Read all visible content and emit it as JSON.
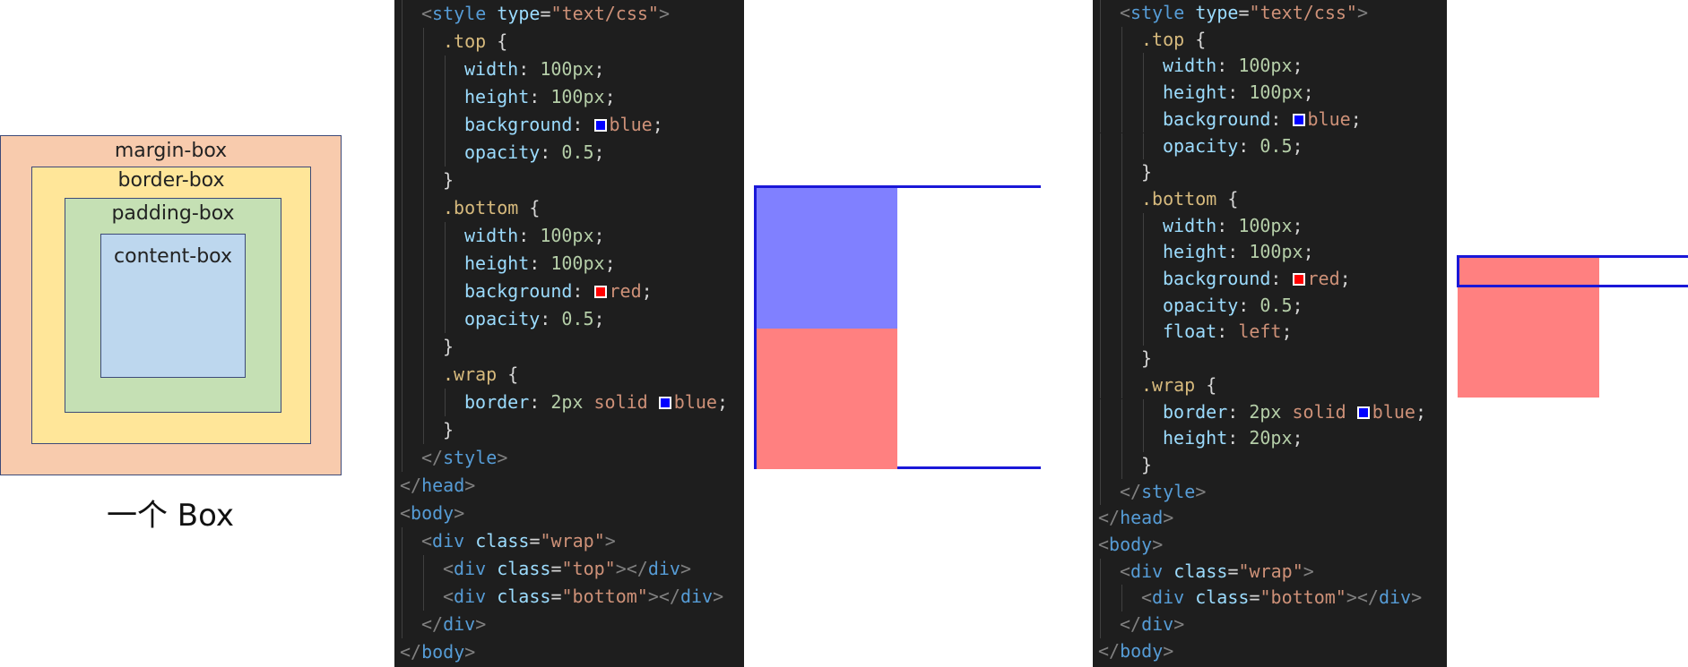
{
  "box_model": {
    "margin_box": "margin-box",
    "border_box": "border-box",
    "padding_box": "padding-box",
    "content_box": "content-box",
    "caption": "一个 Box",
    "colors": {
      "margin": "#f8cbad",
      "border": "#ffe699",
      "padding": "#c5e0b4",
      "content": "#bdd7ee"
    }
  },
  "code1": {
    "lines": [
      {
        "indent": 1,
        "tokens": [
          [
            "t-punc",
            "<"
          ],
          [
            "t-tag",
            "style"
          ],
          [
            "t-text",
            " "
          ],
          [
            "t-attr",
            "type"
          ],
          [
            "t-text",
            "="
          ],
          [
            "t-str",
            "\"text/css\""
          ],
          [
            "t-punc",
            ">"
          ]
        ]
      },
      {
        "indent": 2,
        "tokens": [
          [
            "t-sel",
            ".top"
          ],
          [
            "t-text",
            " {"
          ]
        ]
      },
      {
        "indent": 3,
        "tokens": [
          [
            "t-prop",
            "width"
          ],
          [
            "t-text",
            ": "
          ],
          [
            "t-num",
            "100px"
          ],
          [
            "t-text",
            ";"
          ]
        ]
      },
      {
        "indent": 3,
        "tokens": [
          [
            "t-prop",
            "height"
          ],
          [
            "t-text",
            ": "
          ],
          [
            "t-num",
            "100px"
          ],
          [
            "t-text",
            ";"
          ]
        ]
      },
      {
        "indent": 3,
        "tokens": [
          [
            "t-prop",
            "background"
          ],
          [
            "t-text",
            ": "
          ],
          [
            "swatch",
            "#0000ff"
          ],
          [
            "t-val",
            "blue"
          ],
          [
            "t-text",
            ";"
          ]
        ]
      },
      {
        "indent": 3,
        "tokens": [
          [
            "t-prop",
            "opacity"
          ],
          [
            "t-text",
            ": "
          ],
          [
            "t-num",
            "0.5"
          ],
          [
            "t-text",
            ";"
          ]
        ]
      },
      {
        "indent": 2,
        "tokens": [
          [
            "t-text",
            "}"
          ]
        ]
      },
      {
        "indent": 2,
        "tokens": [
          [
            "t-sel",
            ".bottom"
          ],
          [
            "t-text",
            " {"
          ]
        ]
      },
      {
        "indent": 3,
        "tokens": [
          [
            "t-prop",
            "width"
          ],
          [
            "t-text",
            ": "
          ],
          [
            "t-num",
            "100px"
          ],
          [
            "t-text",
            ";"
          ]
        ]
      },
      {
        "indent": 3,
        "tokens": [
          [
            "t-prop",
            "height"
          ],
          [
            "t-text",
            ": "
          ],
          [
            "t-num",
            "100px"
          ],
          [
            "t-text",
            ";"
          ]
        ]
      },
      {
        "indent": 3,
        "tokens": [
          [
            "t-prop",
            "background"
          ],
          [
            "t-text",
            ": "
          ],
          [
            "swatch",
            "#ff0000"
          ],
          [
            "t-val",
            "red"
          ],
          [
            "t-text",
            ";"
          ]
        ]
      },
      {
        "indent": 3,
        "tokens": [
          [
            "t-prop",
            "opacity"
          ],
          [
            "t-text",
            ": "
          ],
          [
            "t-num",
            "0.5"
          ],
          [
            "t-text",
            ";"
          ]
        ]
      },
      {
        "indent": 2,
        "tokens": [
          [
            "t-text",
            "}"
          ]
        ]
      },
      {
        "indent": 2,
        "tokens": [
          [
            "t-sel",
            ".wrap"
          ],
          [
            "t-text",
            " {"
          ]
        ]
      },
      {
        "indent": 3,
        "tokens": [
          [
            "t-prop",
            "border"
          ],
          [
            "t-text",
            ": "
          ],
          [
            "t-num",
            "2px"
          ],
          [
            "t-text",
            " "
          ],
          [
            "t-val",
            "solid"
          ],
          [
            "t-text",
            " "
          ],
          [
            "swatch",
            "#0000ff"
          ],
          [
            "t-val",
            "blue"
          ],
          [
            "t-text",
            ";"
          ]
        ]
      },
      {
        "indent": 2,
        "tokens": [
          [
            "t-text",
            "}"
          ]
        ]
      },
      {
        "indent": 1,
        "tokens": [
          [
            "t-punc",
            "</"
          ],
          [
            "t-tag",
            "style"
          ],
          [
            "t-punc",
            ">"
          ]
        ]
      },
      {
        "indent": 0,
        "tokens": [
          [
            "t-punc",
            "</"
          ],
          [
            "t-tag",
            "head"
          ],
          [
            "t-punc",
            ">"
          ]
        ]
      },
      {
        "indent": 0,
        "tokens": [
          [
            "t-punc",
            "<"
          ],
          [
            "t-tag",
            "body"
          ],
          [
            "t-punc",
            ">"
          ]
        ]
      },
      {
        "indent": 1,
        "tokens": [
          [
            "t-punc",
            "<"
          ],
          [
            "t-tag",
            "div"
          ],
          [
            "t-text",
            " "
          ],
          [
            "t-attr",
            "class"
          ],
          [
            "t-text",
            "="
          ],
          [
            "t-str",
            "\"wrap\""
          ],
          [
            "t-punc",
            ">"
          ]
        ]
      },
      {
        "indent": 2,
        "tokens": [
          [
            "t-punc",
            "<"
          ],
          [
            "t-tag",
            "div"
          ],
          [
            "t-text",
            " "
          ],
          [
            "t-attr",
            "class"
          ],
          [
            "t-text",
            "="
          ],
          [
            "t-str",
            "\"top\""
          ],
          [
            "t-punc",
            "></"
          ],
          [
            "t-tag",
            "div"
          ],
          [
            "t-punc",
            ">"
          ]
        ]
      },
      {
        "indent": 2,
        "tokens": [
          [
            "t-punc",
            "<"
          ],
          [
            "t-tag",
            "div"
          ],
          [
            "t-text",
            " "
          ],
          [
            "t-attr",
            "class"
          ],
          [
            "t-text",
            "="
          ],
          [
            "t-str",
            "\"bottom\""
          ],
          [
            "t-punc",
            "></"
          ],
          [
            "t-tag",
            "div"
          ],
          [
            "t-punc",
            ">"
          ]
        ]
      },
      {
        "indent": 1,
        "tokens": [
          [
            "t-punc",
            "</"
          ],
          [
            "t-tag",
            "div"
          ],
          [
            "t-punc",
            ">"
          ]
        ]
      },
      {
        "indent": 0,
        "tokens": [
          [
            "t-punc",
            "</"
          ],
          [
            "t-tag",
            "body"
          ],
          [
            "t-punc",
            ">"
          ]
        ]
      }
    ]
  },
  "code2": {
    "lines": [
      {
        "indent": 1,
        "tokens": [
          [
            "t-punc",
            "<"
          ],
          [
            "t-tag",
            "style"
          ],
          [
            "t-text",
            " "
          ],
          [
            "t-attr",
            "type"
          ],
          [
            "t-text",
            "="
          ],
          [
            "t-str",
            "\"text/css\""
          ],
          [
            "t-punc",
            ">"
          ]
        ]
      },
      {
        "indent": 2,
        "tokens": [
          [
            "t-sel",
            ".top"
          ],
          [
            "t-text",
            " {"
          ]
        ]
      },
      {
        "indent": 3,
        "tokens": [
          [
            "t-prop",
            "width"
          ],
          [
            "t-text",
            ": "
          ],
          [
            "t-num",
            "100px"
          ],
          [
            "t-text",
            ";"
          ]
        ]
      },
      {
        "indent": 3,
        "tokens": [
          [
            "t-prop",
            "height"
          ],
          [
            "t-text",
            ": "
          ],
          [
            "t-num",
            "100px"
          ],
          [
            "t-text",
            ";"
          ]
        ]
      },
      {
        "indent": 3,
        "tokens": [
          [
            "t-prop",
            "background"
          ],
          [
            "t-text",
            ": "
          ],
          [
            "swatch",
            "#0000ff"
          ],
          [
            "t-val",
            "blue"
          ],
          [
            "t-text",
            ";"
          ]
        ]
      },
      {
        "indent": 3,
        "tokens": [
          [
            "t-prop",
            "opacity"
          ],
          [
            "t-text",
            ": "
          ],
          [
            "t-num",
            "0.5"
          ],
          [
            "t-text",
            ";"
          ]
        ]
      },
      {
        "indent": 2,
        "tokens": [
          [
            "t-text",
            "}"
          ]
        ]
      },
      {
        "indent": 2,
        "tokens": [
          [
            "t-sel",
            ".bottom"
          ],
          [
            "t-text",
            " {"
          ]
        ]
      },
      {
        "indent": 3,
        "tokens": [
          [
            "t-prop",
            "width"
          ],
          [
            "t-text",
            ": "
          ],
          [
            "t-num",
            "100px"
          ],
          [
            "t-text",
            ";"
          ]
        ]
      },
      {
        "indent": 3,
        "tokens": [
          [
            "t-prop",
            "height"
          ],
          [
            "t-text",
            ": "
          ],
          [
            "t-num",
            "100px"
          ],
          [
            "t-text",
            ";"
          ]
        ]
      },
      {
        "indent": 3,
        "tokens": [
          [
            "t-prop",
            "background"
          ],
          [
            "t-text",
            ": "
          ],
          [
            "swatch",
            "#ff0000"
          ],
          [
            "t-val",
            "red"
          ],
          [
            "t-text",
            ";"
          ]
        ]
      },
      {
        "indent": 3,
        "tokens": [
          [
            "t-prop",
            "opacity"
          ],
          [
            "t-text",
            ": "
          ],
          [
            "t-num",
            "0.5"
          ],
          [
            "t-text",
            ";"
          ]
        ]
      },
      {
        "indent": 3,
        "tokens": [
          [
            "t-prop",
            "float"
          ],
          [
            "t-text",
            ": "
          ],
          [
            "t-val",
            "left"
          ],
          [
            "t-text",
            ";"
          ]
        ]
      },
      {
        "indent": 2,
        "tokens": [
          [
            "t-text",
            "}"
          ]
        ]
      },
      {
        "indent": 2,
        "tokens": [
          [
            "t-sel",
            ".wrap"
          ],
          [
            "t-text",
            " {"
          ]
        ]
      },
      {
        "indent": 3,
        "tokens": [
          [
            "t-prop",
            "border"
          ],
          [
            "t-text",
            ": "
          ],
          [
            "t-num",
            "2px"
          ],
          [
            "t-text",
            " "
          ],
          [
            "t-val",
            "solid"
          ],
          [
            "t-text",
            " "
          ],
          [
            "swatch",
            "#0000ff"
          ],
          [
            "t-val",
            "blue"
          ],
          [
            "t-text",
            ";"
          ]
        ]
      },
      {
        "indent": 3,
        "tokens": [
          [
            "t-prop",
            "height"
          ],
          [
            "t-text",
            ": "
          ],
          [
            "t-num",
            "20px"
          ],
          [
            "t-text",
            ";"
          ]
        ]
      },
      {
        "indent": 2,
        "tokens": [
          [
            "t-text",
            "}"
          ]
        ]
      },
      {
        "indent": 1,
        "tokens": [
          [
            "t-punc",
            "</"
          ],
          [
            "t-tag",
            "style"
          ],
          [
            "t-punc",
            ">"
          ]
        ]
      },
      {
        "indent": 0,
        "tokens": [
          [
            "t-punc",
            "</"
          ],
          [
            "t-tag",
            "head"
          ],
          [
            "t-punc",
            ">"
          ]
        ]
      },
      {
        "indent": 0,
        "tokens": [
          [
            "t-punc",
            "<"
          ],
          [
            "t-tag",
            "body"
          ],
          [
            "t-punc",
            ">"
          ]
        ]
      },
      {
        "indent": 1,
        "tokens": [
          [
            "t-punc",
            "<"
          ],
          [
            "t-tag",
            "div"
          ],
          [
            "t-text",
            " "
          ],
          [
            "t-attr",
            "class"
          ],
          [
            "t-text",
            "="
          ],
          [
            "t-str",
            "\"wrap\""
          ],
          [
            "t-punc",
            ">"
          ]
        ]
      },
      {
        "indent": 2,
        "tokens": [
          [
            "t-punc",
            "<"
          ],
          [
            "t-tag",
            "div"
          ],
          [
            "t-text",
            " "
          ],
          [
            "t-attr",
            "class"
          ],
          [
            "t-text",
            "="
          ],
          [
            "t-str",
            "\"bottom\""
          ],
          [
            "t-punc",
            "></"
          ],
          [
            "t-tag",
            "div"
          ],
          [
            "t-punc",
            ">"
          ]
        ]
      },
      {
        "indent": 1,
        "tokens": [
          [
            "t-punc",
            "</"
          ],
          [
            "t-tag",
            "div"
          ],
          [
            "t-punc",
            ">"
          ]
        ]
      },
      {
        "indent": 0,
        "tokens": [
          [
            "t-punc",
            "</"
          ],
          [
            "t-tag",
            "body"
          ],
          [
            "t-punc",
            ">"
          ]
        ]
      }
    ]
  },
  "preview_colors": {
    "wrap_border": "#1a17d8",
    "top_fill": "#8080ff",
    "bottom_fill": "#ff8080"
  }
}
